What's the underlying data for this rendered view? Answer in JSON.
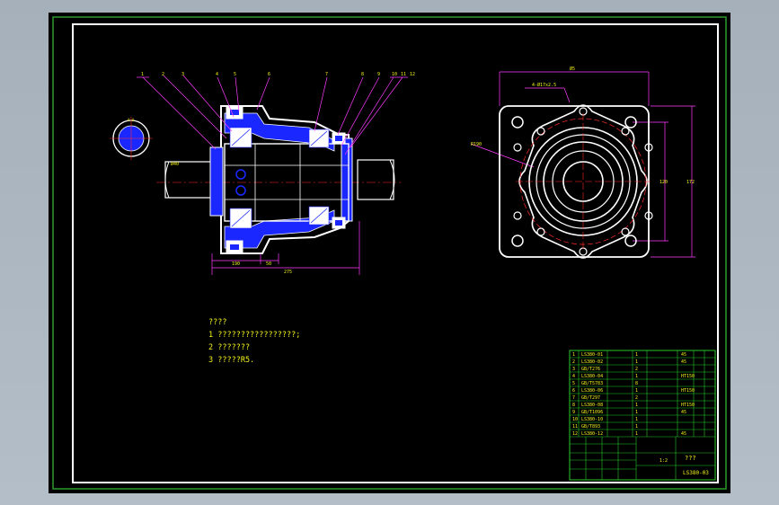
{
  "drawing": {
    "notes_title": "????",
    "notes": [
      "1  ?????????????????;",
      "2  ???????",
      "3  ?????R5."
    ],
    "top_callouts": [
      "1",
      "2",
      "3",
      "4",
      "5",
      "6",
      "7",
      "8",
      "9",
      "10",
      "11",
      "12"
    ],
    "dims": {
      "d1": "Ø40",
      "d2": "190",
      "d3": "50",
      "d4": "275",
      "phi_top": "Ø5",
      "holes": "4-Ø17x2.5",
      "r_label": "R190",
      "v1": "120",
      "v2": "172"
    },
    "title_block": {
      "title": "???",
      "scale": "1:2",
      "drawing_no": "LS380-03"
    }
  },
  "colors": {
    "frame_outer": "#2e9a2e",
    "frame_inner": "#ffffff",
    "part_blue": "#2a3cff",
    "part_white": "#ffffff",
    "center_red": "#ff2a2a",
    "leader_magenta": "#ff3cff",
    "text_yellow": "#f2f21c",
    "table_green": "#28c828"
  }
}
